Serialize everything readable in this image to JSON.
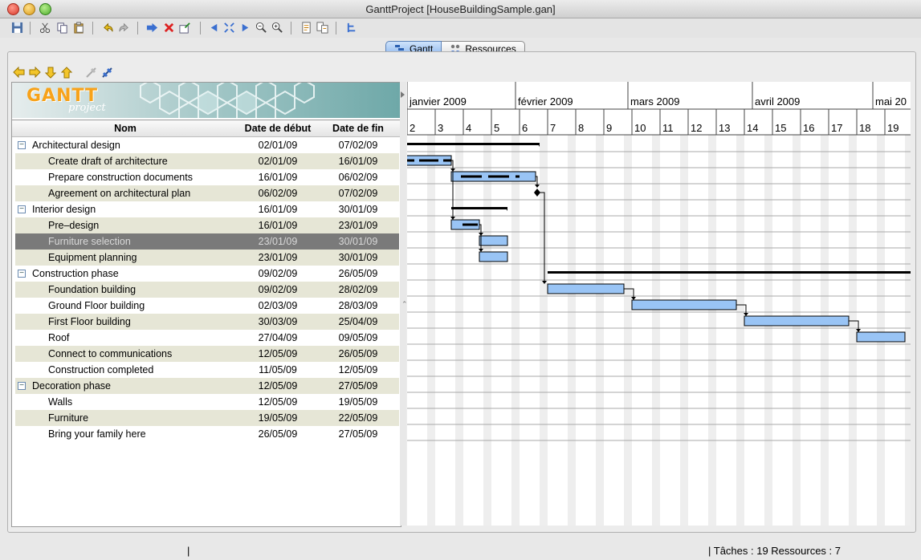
{
  "window": {
    "title": "GanttProject [HouseBuildingSample.gan]"
  },
  "tabs": [
    {
      "label": "Gantt",
      "active": true
    },
    {
      "label": "Ressources",
      "active": false
    }
  ],
  "logo": {
    "brand": "GANTT",
    "sub": "project"
  },
  "table": {
    "columns": [
      "Nom",
      "Date de début",
      "Date de fin"
    ],
    "rows": [
      {
        "name": "Architectural design",
        "start": "02/01/09",
        "end": "07/02/09",
        "level": 0,
        "group": true
      },
      {
        "name": "Create draft of architecture",
        "start": "02/01/09",
        "end": "16/01/09",
        "level": 1
      },
      {
        "name": "Prepare construction documents",
        "start": "16/01/09",
        "end": "06/02/09",
        "level": 1
      },
      {
        "name": "Agreement on architectural plan",
        "start": "06/02/09",
        "end": "07/02/09",
        "level": 1
      },
      {
        "name": "Interior design",
        "start": "16/01/09",
        "end": "30/01/09",
        "level": 0,
        "group": true
      },
      {
        "name": "Pre–design",
        "start": "16/01/09",
        "end": "23/01/09",
        "level": 1
      },
      {
        "name": "Furniture selection",
        "start": "23/01/09",
        "end": "30/01/09",
        "level": 1,
        "selected": true
      },
      {
        "name": "Equipment planning",
        "start": "23/01/09",
        "end": "30/01/09",
        "level": 1
      },
      {
        "name": "Construction phase",
        "start": "09/02/09",
        "end": "26/05/09",
        "level": 0,
        "group": true
      },
      {
        "name": "Foundation building",
        "start": "09/02/09",
        "end": "28/02/09",
        "level": 1
      },
      {
        "name": "Ground Floor building",
        "start": "02/03/09",
        "end": "28/03/09",
        "level": 1
      },
      {
        "name": "First Floor building",
        "start": "30/03/09",
        "end": "25/04/09",
        "level": 1
      },
      {
        "name": "Roof",
        "start": "27/04/09",
        "end": "09/05/09",
        "level": 1
      },
      {
        "name": "Connect to communications",
        "start": "12/05/09",
        "end": "26/05/09",
        "level": 1
      },
      {
        "name": "Construction completed",
        "start": "11/05/09",
        "end": "12/05/09",
        "level": 1
      },
      {
        "name": "Decoration phase",
        "start": "12/05/09",
        "end": "27/05/09",
        "level": 0,
        "group": true
      },
      {
        "name": "Walls",
        "start": "12/05/09",
        "end": "19/05/09",
        "level": 1
      },
      {
        "name": "Furniture",
        "start": "19/05/09",
        "end": "22/05/09",
        "level": 1
      },
      {
        "name": "Bring your family here",
        "start": "26/05/09",
        "end": "27/05/09",
        "level": 1
      }
    ]
  },
  "timeline": {
    "months": [
      "janvier 2009",
      "février 2009",
      "mars 2009",
      "avril 2009",
      "mai 20"
    ],
    "weeks": [
      "2",
      "3",
      "4",
      "5",
      "6",
      "7",
      "8",
      "9",
      "10",
      "11",
      "12",
      "13",
      "14",
      "15",
      "16",
      "17",
      "18",
      "19"
    ]
  },
  "status": {
    "text": "| Tâches : 19  Ressources : 7",
    "left_mark": "|"
  },
  "colors": {
    "bar": "#99c4f5",
    "selected_row": "#7a7a7a",
    "alt_row": "#e6e6d6"
  }
}
